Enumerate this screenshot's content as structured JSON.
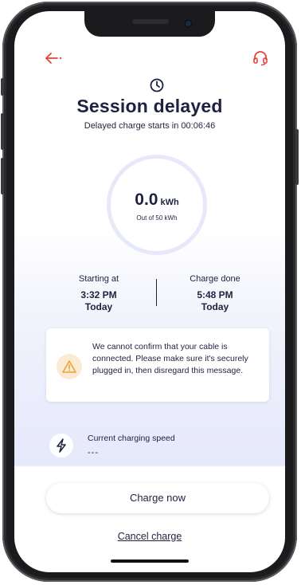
{
  "header": {
    "back_icon": "back-arrow-icon",
    "support_icon": "headset-icon",
    "accent_color": "#e8423e"
  },
  "session": {
    "title": "Session delayed",
    "countdown": "Delayed charge starts in 00:06:46",
    "energy_value": "0.0",
    "energy_unit": "kWh",
    "energy_target": "Out of 50 kWh"
  },
  "schedule": {
    "start_label": "Starting at",
    "start_time": "3:32 PM",
    "start_day": "Today",
    "done_label": "Charge done",
    "done_time": "5:48 PM",
    "done_day": "Today"
  },
  "warning": {
    "icon": "warning-triangle-icon",
    "message": "We cannot confirm that your cable is connected. Please make sure it's securely plugged in, then disregard this message."
  },
  "speed": {
    "icon": "lightning-icon",
    "label": "Current charging speed",
    "value": "---"
  },
  "actions": {
    "charge_now": "Charge now",
    "cancel": "Cancel charge"
  }
}
